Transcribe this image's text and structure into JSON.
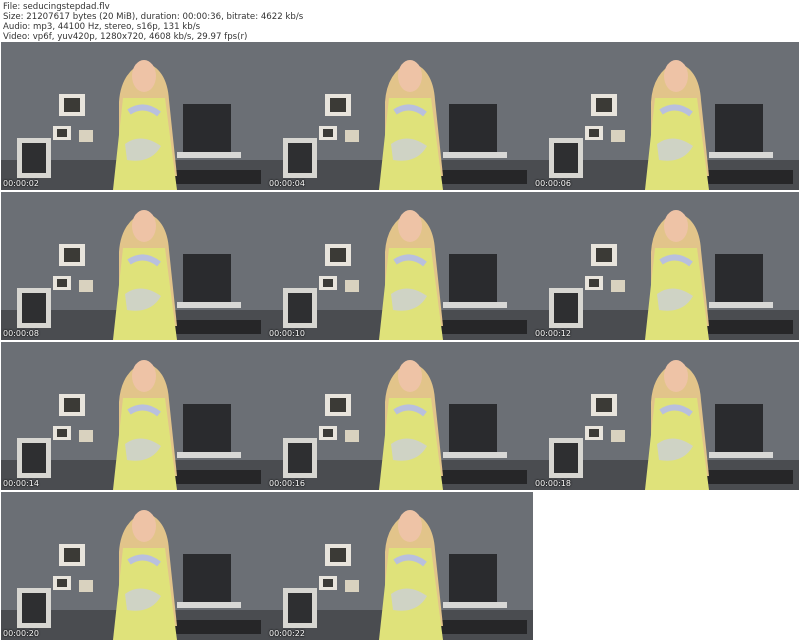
{
  "header": {
    "file": "File: seducingstepdad.flv",
    "size": "Size: 21207617 bytes (20 MiB), duration: 00:00:36, bitrate: 4622 kb/s",
    "audio": "Audio: mp3, 44100 Hz, stereo, s16p, 131 kb/s",
    "video": "Video: vp6f, yuv420p, 1280x720, 4608 kb/s, 29.97 fps(r)"
  },
  "thumbnails": [
    {
      "timestamp": "00:00:02"
    },
    {
      "timestamp": "00:00:04"
    },
    {
      "timestamp": "00:00:06"
    },
    {
      "timestamp": "00:00:08"
    },
    {
      "timestamp": "00:00:10"
    },
    {
      "timestamp": "00:00:12"
    },
    {
      "timestamp": "00:00:14"
    },
    {
      "timestamp": "00:00:16"
    },
    {
      "timestamp": "00:00:18"
    },
    {
      "timestamp": "00:00:20"
    },
    {
      "timestamp": "00:00:22"
    }
  ],
  "colors": {
    "wall": "#6a6d73",
    "dress": "#dfe27a",
    "hair": "#e2c48a",
    "skin": "#eec3a6"
  }
}
